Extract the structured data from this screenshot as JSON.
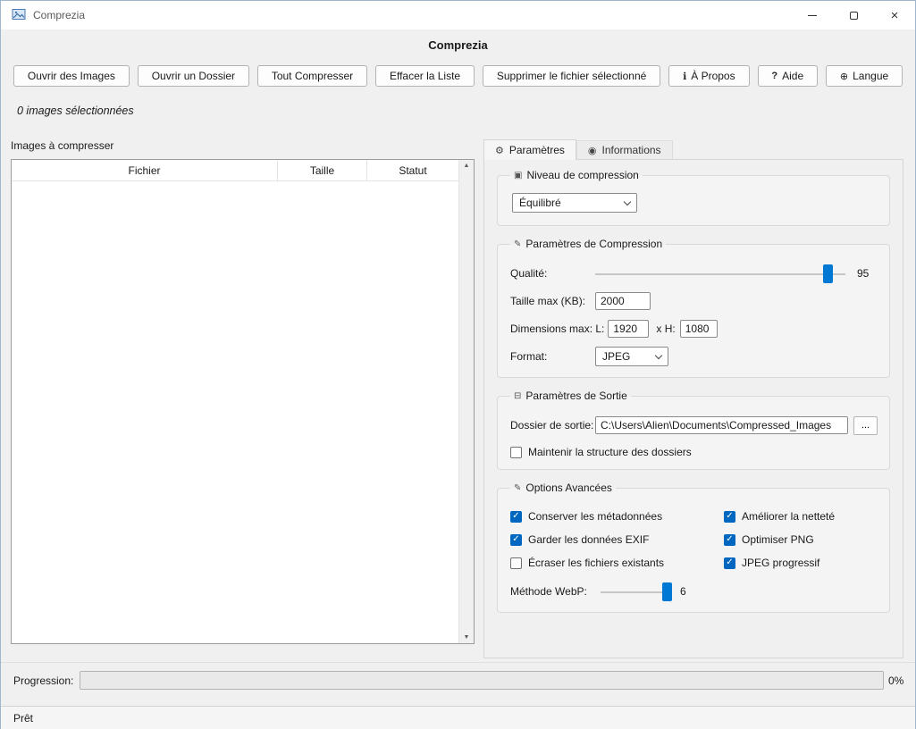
{
  "window": {
    "titlebar_title": "Comprezia",
    "heading": "Comprezia"
  },
  "icons": {
    "close": "×",
    "scroll_up": "▲",
    "scroll_down": "▼",
    "about": "ℹ",
    "help": "?",
    "language": "⊕",
    "tab_settings": "⚙",
    "tab_info": "◉",
    "group_level": "▣",
    "group_compression": "✎",
    "group_output": "⊟",
    "group_advanced": "✎",
    "check": "✓"
  },
  "toolbar": {
    "buttons": [
      {
        "label": "Ouvrir des Images"
      },
      {
        "label": "Ouvrir un Dossier"
      },
      {
        "label": "Tout Compresser"
      },
      {
        "label": "Effacer la Liste"
      },
      {
        "label": "Supprimer le fichier sélectionné"
      },
      {
        "label": "À Propos",
        "icon": "ℹ"
      },
      {
        "label": "Aide",
        "icon": "?"
      },
      {
        "label": "Langue",
        "icon": "⊕"
      }
    ]
  },
  "selection_status": "0 images sélectionnées",
  "file_list": {
    "label": "Images à compresser",
    "columns": [
      "Fichier",
      "Taille",
      "Statut"
    ],
    "rows": []
  },
  "tabs": [
    {
      "label": "Paramètres",
      "icon": "⚙",
      "active": true
    },
    {
      "label": "Informations",
      "icon": "◉",
      "active": false
    }
  ],
  "settings": {
    "level_group": {
      "title": "Niveau de compression",
      "selected_option": "Équilibré"
    },
    "compression_group": {
      "title": "Paramètres de Compression",
      "quality_label": "Qualité:",
      "quality_value": "95",
      "max_size_label": "Taille max (KB):",
      "max_size_value": "2000",
      "dimensions_label": "Dimensions max: L:",
      "width_value": "1920",
      "height_label": "x H:",
      "height_value": "1080",
      "format_label": "Format:",
      "format_value": "JPEG"
    },
    "output_group": {
      "title": "Paramètres de Sortie",
      "dir_label": "Dossier de sortie:",
      "dir_value": "C:\\Users\\Alien\\Documents\\Compressed_Images",
      "browse_label": "...",
      "keep_structure_label": "Maintenir la structure des dossiers",
      "keep_structure_checked": false
    },
    "advanced_group": {
      "title": "Options Avancées",
      "checkboxes": [
        {
          "label": "Conserver les métadonnées",
          "checked": true
        },
        {
          "label": "Améliorer la netteté",
          "checked": true
        },
        {
          "label": "Garder les données EXIF",
          "checked": true
        },
        {
          "label": "Optimiser PNG",
          "checked": true
        },
        {
          "label": "Écraser les fichiers existants",
          "checked": false
        },
        {
          "label": "JPEG progressif",
          "checked": true
        }
      ],
      "webp_label": "Méthode WebP:",
      "webp_value": "6"
    }
  },
  "progress": {
    "label": "Progression:",
    "percent_label": "0%",
    "value": 0
  },
  "statusbar": {
    "text": "Prêt"
  },
  "colors": {
    "accent": "#0078d4",
    "checkbox": "#0067c0"
  }
}
